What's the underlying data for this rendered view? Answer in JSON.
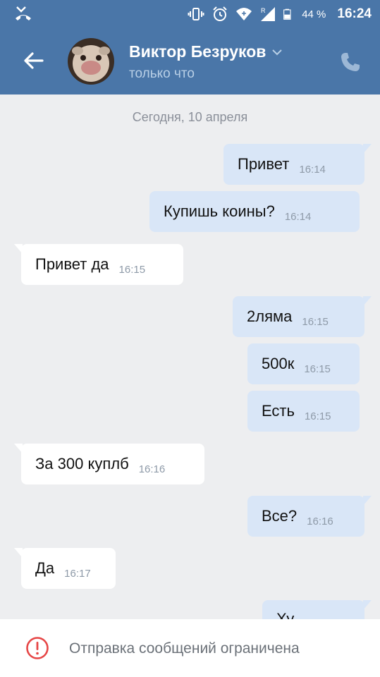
{
  "status_bar": {
    "battery_percent": "44 %",
    "time": "16:24",
    "icons": [
      "missed-call-icon",
      "vibrate-icon",
      "alarm-icon",
      "wifi-icon",
      "signal-icon",
      "battery-icon"
    ]
  },
  "header": {
    "contact_name": "Виктор Безруков",
    "contact_status": "только что",
    "icons": [
      "back-arrow-icon",
      "chevron-down-icon",
      "phone-icon"
    ]
  },
  "chat": {
    "date_separator": "Сегодня, 10 апреля",
    "messages": [
      {
        "dir": "out",
        "text": "Привет",
        "time": "16:14"
      },
      {
        "dir": "out",
        "text": "Купишь коины?",
        "time": "16:14"
      },
      {
        "dir": "in",
        "text": "Привет да",
        "time": "16:15"
      },
      {
        "dir": "out",
        "text": "2ляма",
        "time": "16:15"
      },
      {
        "dir": "out",
        "text": "500к",
        "time": "16:15"
      },
      {
        "dir": "out",
        "text": "Есть",
        "time": "16:15"
      },
      {
        "dir": "in",
        "text": "За 300 куплб",
        "time": "16:16"
      },
      {
        "dir": "out",
        "text": "Все?",
        "time": "16:16"
      },
      {
        "dir": "in",
        "text": "Да",
        "time": "16:17"
      },
      {
        "dir": "out",
        "text": "Ху",
        "time": ""
      }
    ]
  },
  "footer": {
    "notice": "Отправка сообщений ограничена",
    "icon": "warning-circle-icon"
  },
  "colors": {
    "header_blue": "#4a76a8",
    "outgoing_bubble": "#d9e6f7",
    "incoming_bubble": "#ffffff",
    "chat_background": "#edeef0",
    "warning_red": "#e64646"
  }
}
